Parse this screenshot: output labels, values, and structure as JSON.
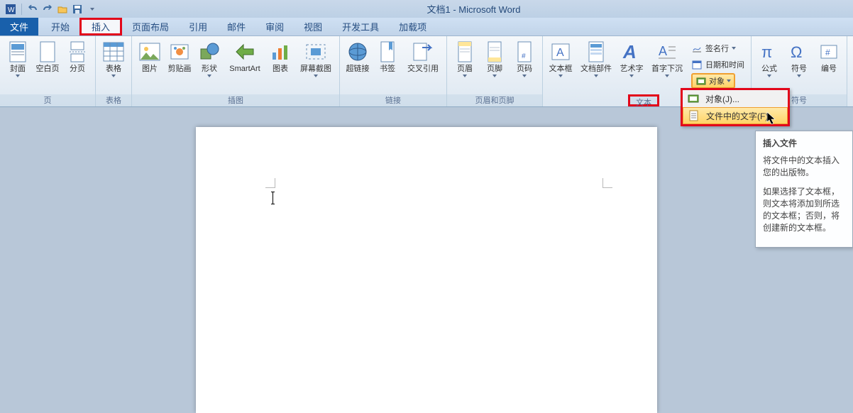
{
  "title": "文档1 - Microsoft Word",
  "tabs": {
    "file": "文件",
    "home": "开始",
    "insert": "插入",
    "layout": "页面布局",
    "ref": "引用",
    "mail": "邮件",
    "review": "审阅",
    "view": "视图",
    "dev": "开发工具",
    "addin": "加载项"
  },
  "groups": {
    "pages": "页",
    "tables": "表格",
    "illus": "插图",
    "links": "链接",
    "hf": "页眉和页脚",
    "text": "文本",
    "symbols": "符号"
  },
  "btn": {
    "cover": "封面",
    "blank": "空白页",
    "break": "分页",
    "table": "表格",
    "pic": "图片",
    "clip": "剪贴画",
    "shape": "形状",
    "smartart": "SmartArt",
    "chart": "图表",
    "screenshot": "屏幕截图",
    "hyperlink": "超链接",
    "bookmark": "书签",
    "crossref": "交叉引用",
    "header": "页眉",
    "footer": "页脚",
    "pagenum": "页码",
    "textbox": "文本框",
    "quickparts": "文档部件",
    "wordart": "艺术字",
    "dropcap": "首字下沉",
    "sigline": "签名行",
    "datetime": "日期和时间",
    "object": "对象",
    "equation": "公式",
    "symbol": "符号",
    "number": "编号"
  },
  "menu": {
    "object": "对象(J)...",
    "textfromfile": "文件中的文字(F)..."
  },
  "tooltip": {
    "title": "插入文件",
    "p1": "将文件中的文本插入您的出版物。",
    "p2": "如果选择了文本框，则文本将添加到所选的文本框；否则，将创建新的文本框。"
  }
}
